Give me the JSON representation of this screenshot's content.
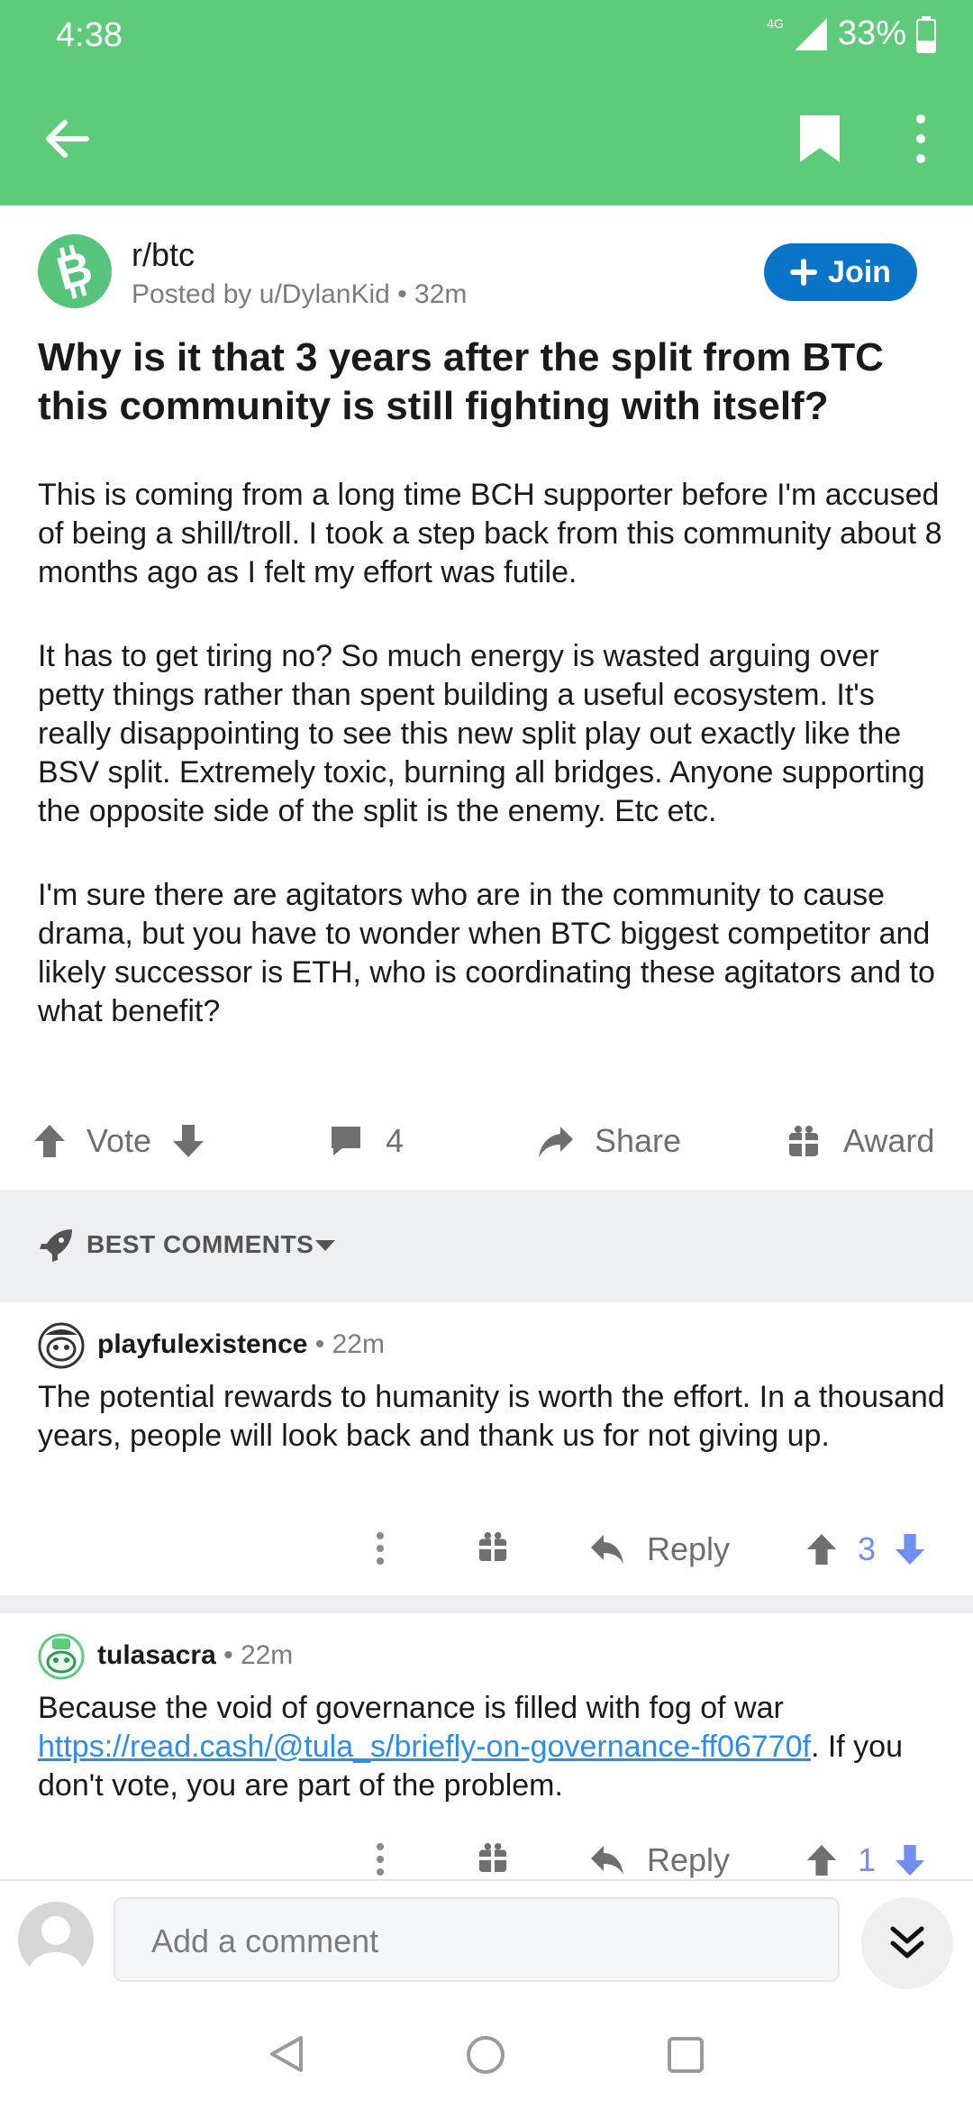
{
  "status_bar": {
    "time": "4:38",
    "network": "4G",
    "battery": "33%"
  },
  "toolbar": {
    "back_icon": "arrow-left-icon",
    "bookmark_icon": "bookmark-icon",
    "more_icon": "more-vertical-icon"
  },
  "post": {
    "subreddit": "r/btc",
    "posted_by": "Posted by u/DylanKid",
    "age": "32m",
    "join_label": "Join",
    "title": "Why is it that 3 years after the split from BTC this community is still fighting with itself?",
    "body": [
      "This is coming from a long time BCH supporter before I'm accused of being a shill/troll. I took a step back from this community about 8 months ago as I felt my effort was futile.",
      "It has to get tiring no? So much energy is wasted arguing over petty things rather than spent building a useful ecosystem. It's really disappointing to see this new split play out exactly like the BSV split. Extremely toxic, burning all bridges. Anyone supporting the opposite side of the split is the enemy. Etc etc.",
      "I'm sure there are agitators who are in the community to cause drama, but you have to wonder when BTC biggest competitor and likely successor is ETH, who is coordinating these agitators and to what benefit?"
    ],
    "actions": {
      "vote": "Vote",
      "comments": "4",
      "share": "Share",
      "award": "Award"
    }
  },
  "comments_header": {
    "sort_label": "BEST COMMENTS"
  },
  "comments": [
    {
      "user": "playfulexistence",
      "age": "22m",
      "text": "The potential rewards to humanity is worth the effort. In a thousand years, people will look back and thank us for not giving up.",
      "reply": "Reply",
      "votes": "3"
    },
    {
      "user": "tulasacra",
      "age": "22m",
      "text_before": "Because the void of governance is filled with fog of war ",
      "link": "https://read.cash/@tula_s/briefly-on-governance-ff06770f",
      "text_after": ". If you don't vote, you are part of the problem.",
      "reply": "Reply",
      "votes": "1"
    }
  ],
  "composer": {
    "placeholder": "Add a comment"
  },
  "colors": {
    "header": "#5ecb7b",
    "join": "#0a74c9",
    "link": "#2b8ee8",
    "vote_count": "#6f8ff0"
  }
}
